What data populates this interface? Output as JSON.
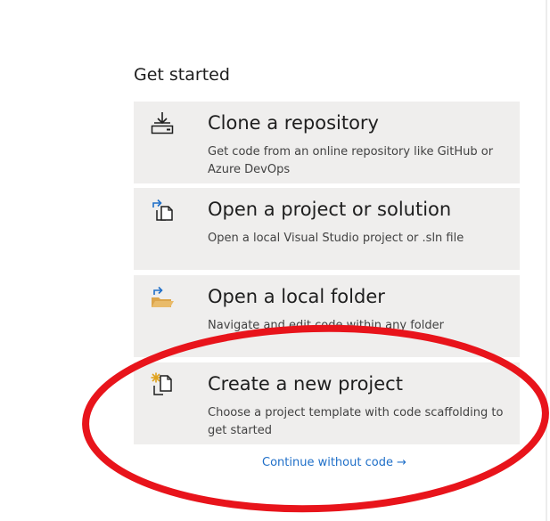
{
  "get_started": {
    "heading": "Get started",
    "cards": [
      {
        "id": "clone",
        "icon": "clone-download-icon",
        "title": "Clone a repository",
        "description": "Get code from an online repository like GitHub or Azure DevOps"
      },
      {
        "id": "open-project",
        "icon": "open-project-icon",
        "title": "Open a project or solution",
        "description": "Open a local Visual Studio project or .sln file"
      },
      {
        "id": "open-folder",
        "icon": "open-folder-icon",
        "title": "Open a local folder",
        "description": "Navigate and edit code within any folder"
      },
      {
        "id": "create",
        "icon": "new-project-icon",
        "title": "Create a new project",
        "description": "Choose a project template with code scaffolding to get started"
      }
    ],
    "continue_link": {
      "label": "Continue without code",
      "arrow": "→"
    }
  },
  "colors": {
    "card_background": "#efeeed",
    "link": "#1f6fc8",
    "annotation_circle": "#e8141b",
    "folder": "#dca54b",
    "star": "#e0a21c"
  }
}
